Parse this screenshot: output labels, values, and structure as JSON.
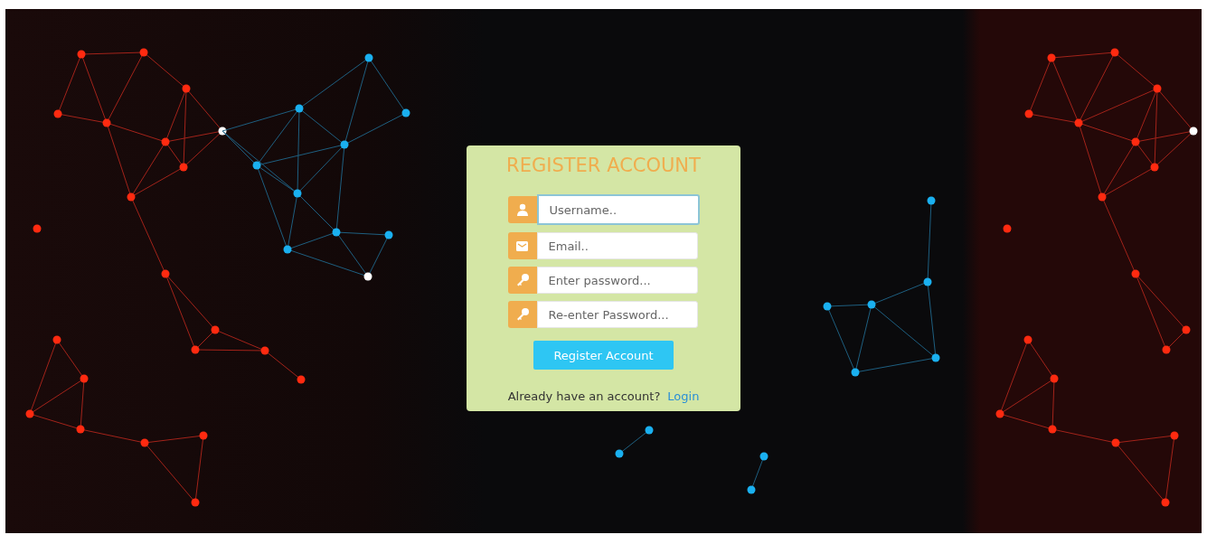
{
  "form": {
    "title": "REGISTER ACCOUNT",
    "fields": [
      {
        "kind": "user",
        "placeholder": "Username..",
        "focused": true
      },
      {
        "kind": "email",
        "placeholder": "Email..",
        "focused": false
      },
      {
        "kind": "key",
        "placeholder": "Enter password...",
        "focused": false
      },
      {
        "kind": "key",
        "placeholder": "Re-enter Password...",
        "focused": false
      }
    ],
    "submit_button": "Register Account",
    "footer": {
      "text": "Already have an account?",
      "link": "Login"
    }
  }
}
